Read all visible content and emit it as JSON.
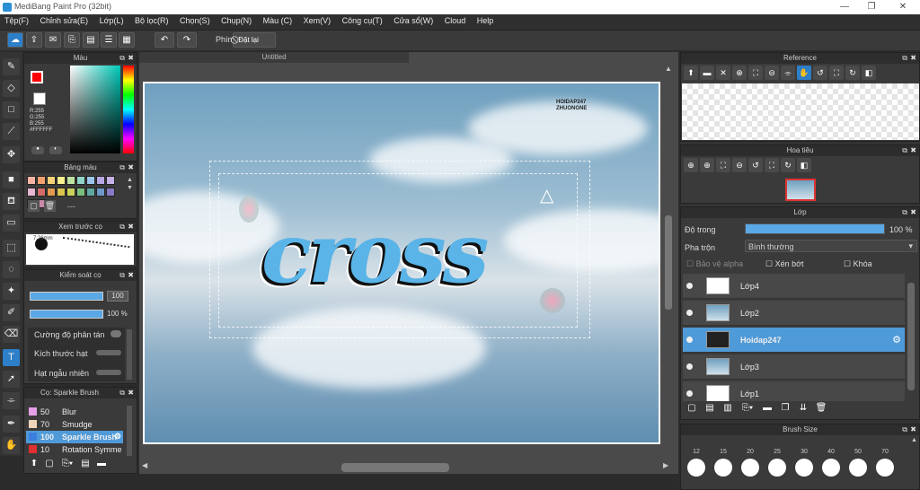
{
  "app": {
    "title": "MediBang Paint Pro (32bit)"
  },
  "menu": [
    "Tệp(F)",
    "Chỉnh sửa(E)",
    "Lớp(L)",
    "Bộ lọc(R)",
    "Chọn(S)",
    "Chụp(N)",
    "Màu (C)",
    "Xem(V)",
    "Công cụ(T)",
    "Cửa sổ(W)",
    "Cloud",
    "Help"
  ],
  "toolbar": {
    "hotkey_label": "Phím",
    "reset_label": "Đặt lại"
  },
  "color_panel": {
    "title": "Màu",
    "r": "R:255",
    "g": "G:255",
    "b": "B:255",
    "hex": "#FFFFFF",
    "primary_color": "#ff0000",
    "secondary_color": "#22cc22"
  },
  "palette_panel": {
    "title": "Bảng màu",
    "dash": "---",
    "swatches": [
      "#f6b3a3",
      "#f2a06e",
      "#f7d27a",
      "#f5ef8f",
      "#bde3a2",
      "#8fd4c6",
      "#9cc5ee",
      "#b9a7e7",
      "#c7b2e8",
      "#e7b6d1",
      "#d46a6a",
      "#e09b4f",
      "#d9c44d",
      "#c9d35a",
      "#7bbf7c",
      "#5fa8a1",
      "#6e98c9",
      "#8a79c7",
      "#a48bc9",
      "#c787a8"
    ]
  },
  "preview_panel": {
    "title": "Xem trước cọ",
    "size": "7.26mm"
  },
  "brush_control": {
    "title": "Kiểm soát cọ",
    "size_value": "100",
    "opacity_value": "100 %",
    "label1": "Cường độ phân tán",
    "label2": "Kích thước hạt",
    "label3": "Hạt ngẫu nhiên"
  },
  "brush_list": {
    "title": "Cọ: Sparkle Brush",
    "items": [
      {
        "size": "50",
        "name": "Blur",
        "color": "#e6a0e6"
      },
      {
        "size": "70",
        "name": "Smudge",
        "color": "#f0d6b8"
      },
      {
        "size": "100",
        "name": "Sparkle Brush",
        "color": "#3a7fe0"
      },
      {
        "size": "10",
        "name": "Rotation Symme",
        "color": "#e03030"
      }
    ]
  },
  "canvas": {
    "tab_title": "Untitled",
    "art_text": "cross",
    "signature_line1": "HOIDAP247",
    "signature_line2": "ZHUONGNE"
  },
  "reference_panel": {
    "title": "Reference"
  },
  "navigator_panel": {
    "title": "Hoa tiêu"
  },
  "layer_panel": {
    "title": "Lớp",
    "opacity_label": "Độ trong",
    "opacity_value": "100 %",
    "opacity_fraction": 1.0,
    "blend_label": "Pha trộn",
    "blend_value": "Bình thường",
    "protect_alpha": "Bảo vệ alpha",
    "clipping": "Xén bớt",
    "lock": "Khóa",
    "layers": [
      "Lớp4",
      "Lớp2",
      "Hoidap247",
      "Lớp3",
      "Lớp1"
    ]
  },
  "brush_size_panel": {
    "title": "Brush Size",
    "sizes": [
      "12",
      "15",
      "20",
      "25",
      "30",
      "40",
      "50",
      "70"
    ]
  }
}
